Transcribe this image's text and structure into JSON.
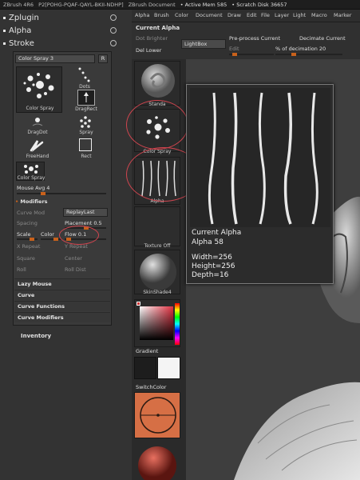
{
  "titlebar": {
    "app": "ZBrush 4R6",
    "serial": "P2[POHG-PQAF-QAYL-BKII-NDHP]",
    "doc": "ZBrush Document",
    "active_mem": "• Active Mem 585",
    "scratch": "• Scratch Disk 36657"
  },
  "palettes": {
    "zplugin": "Zplugin",
    "alpha": "Alpha",
    "stroke": "Stroke"
  },
  "stroke": {
    "header": "Color Spray 3",
    "header_btn": "R",
    "big_label": "Color Spray",
    "icons": [
      "Dots",
      "DragRect",
      "DragDot",
      "Spray",
      "FreeHand",
      "Rect",
      "Color Spray"
    ],
    "mouse_avg": "Mouse Avg 4",
    "modifiers": "Modifiers",
    "curve_mod": "Curve Mod",
    "replay_last": "ReplayLast",
    "spacing": "Spacing",
    "placement": "Placement 0.5",
    "scale": "Scale",
    "color": "Color",
    "flow": "Flow 0.1",
    "x_repeat": "X Repeat",
    "y_repeat": "Y Repeat",
    "square": "Square",
    "center": "Center",
    "roll": "Roll",
    "roll_dist": "Roll Dist",
    "sections": [
      "Lazy Mouse",
      "Curve",
      "Curve Functions",
      "Curve Modifiers"
    ]
  },
  "inventory": "Inventory",
  "mid": {
    "standard": "Standa",
    "color_spray": "Color Spray",
    "alpha": "Alpha",
    "texture": "Texture Off",
    "material": "SkinShade4",
    "gradient": "Gradient",
    "switch_color": "SwitchColor"
  },
  "menu": [
    "Alpha",
    "Brush",
    "Color",
    "Document",
    "Draw",
    "Edit",
    "File",
    "Layer",
    "Light",
    "Macro",
    "Marker"
  ],
  "alpha_panel": {
    "title": "Current Alpha",
    "depth_btn": "Dot Brighter",
    "del_lower": "Del Lower",
    "lightbox": "LightBox",
    "preprocess": "Pre-process Current",
    "decimate": "Decimate Current",
    "edit": "Edit",
    "decimation": "% of decimation 20"
  },
  "popup": {
    "title": "Current Alpha",
    "name": "Alpha 58",
    "width": "Width=256",
    "height": "Height=256",
    "depth": "Depth=16"
  },
  "colors": {
    "accent": "#c8611b",
    "annotation": "#d0454f"
  }
}
